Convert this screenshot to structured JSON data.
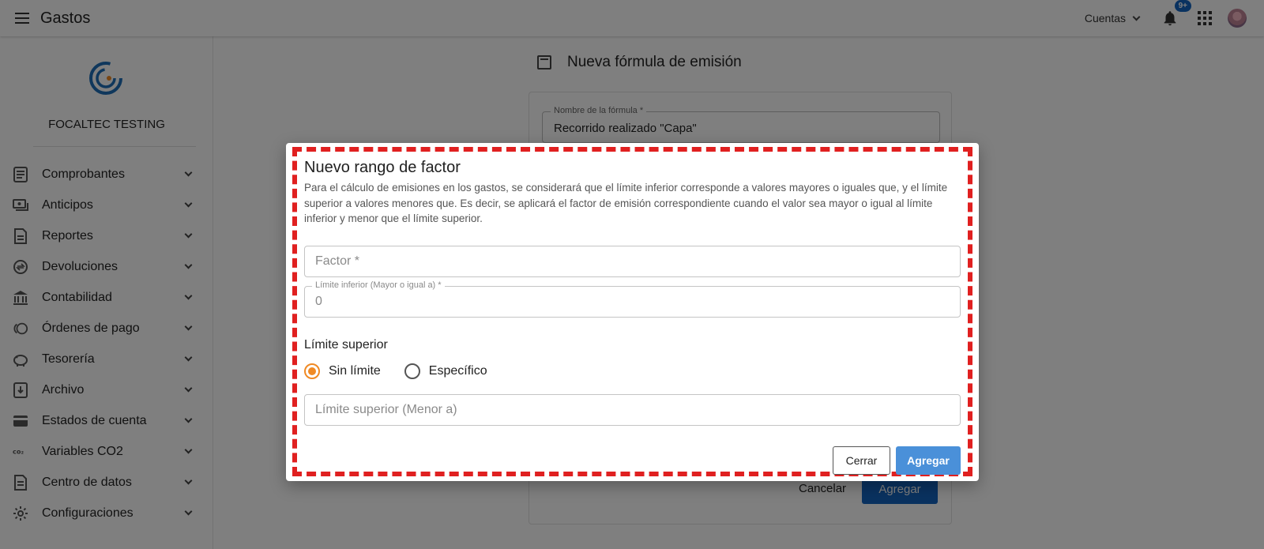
{
  "appbar": {
    "title": "Gastos",
    "accounts_label": "Cuentas",
    "notifications_badge": "9+"
  },
  "sidebar": {
    "org_name": "FOCALTEC TESTING",
    "items": [
      {
        "label": "Comprobantes",
        "icon": "document-icon"
      },
      {
        "label": "Anticipos",
        "icon": "money-icon"
      },
      {
        "label": "Reportes",
        "icon": "report-icon"
      },
      {
        "label": "Devoluciones",
        "icon": "refund-icon"
      },
      {
        "label": "Contabilidad",
        "icon": "bank-icon"
      },
      {
        "label": "Órdenes de pago",
        "icon": "coins-icon"
      },
      {
        "label": "Tesorería",
        "icon": "piggy-bank-icon"
      },
      {
        "label": "Archivo",
        "icon": "archive-icon"
      },
      {
        "label": "Estados de cuenta",
        "icon": "card-icon"
      },
      {
        "label": "Variables CO2",
        "icon": "co2-icon"
      },
      {
        "label": "Centro de datos",
        "icon": "data-icon"
      },
      {
        "label": "Configuraciones",
        "icon": "gear-icon"
      }
    ]
  },
  "main": {
    "title": "Nueva fórmula de emisión",
    "formula_name_label": "Nombre de la fórmula *",
    "formula_name_value": "Recorrido realizado \"Capa\"",
    "cancel_label": "Cancelar",
    "add_label": "Agregar"
  },
  "dialog": {
    "title": "Nuevo rango de factor",
    "description": "Para el cálculo de emisiones en los gastos, se considerará que el límite inferior corresponde a valores mayores o iguales que, y el límite superior a valores menores que. Es decir, se aplicará el factor de emisión correspondiente cuando el valor sea mayor o igual al límite inferior y menor que el límite superior.",
    "factor_placeholder": "Factor *",
    "lower_limit_label": "Límite inferior (Mayor o igual a) *",
    "lower_limit_value": "0",
    "upper_section_label": "Límite superior",
    "radio_no_limit": "Sin límite",
    "radio_specific": "Específico",
    "upper_limit_placeholder": "Límite superior (Menor a)",
    "close_label": "Cerrar",
    "add_label": "Agregar"
  },
  "colors": {
    "accent": "#f08a24",
    "primary_button": "#4a90d9",
    "highlight_frame": "#e02020"
  }
}
